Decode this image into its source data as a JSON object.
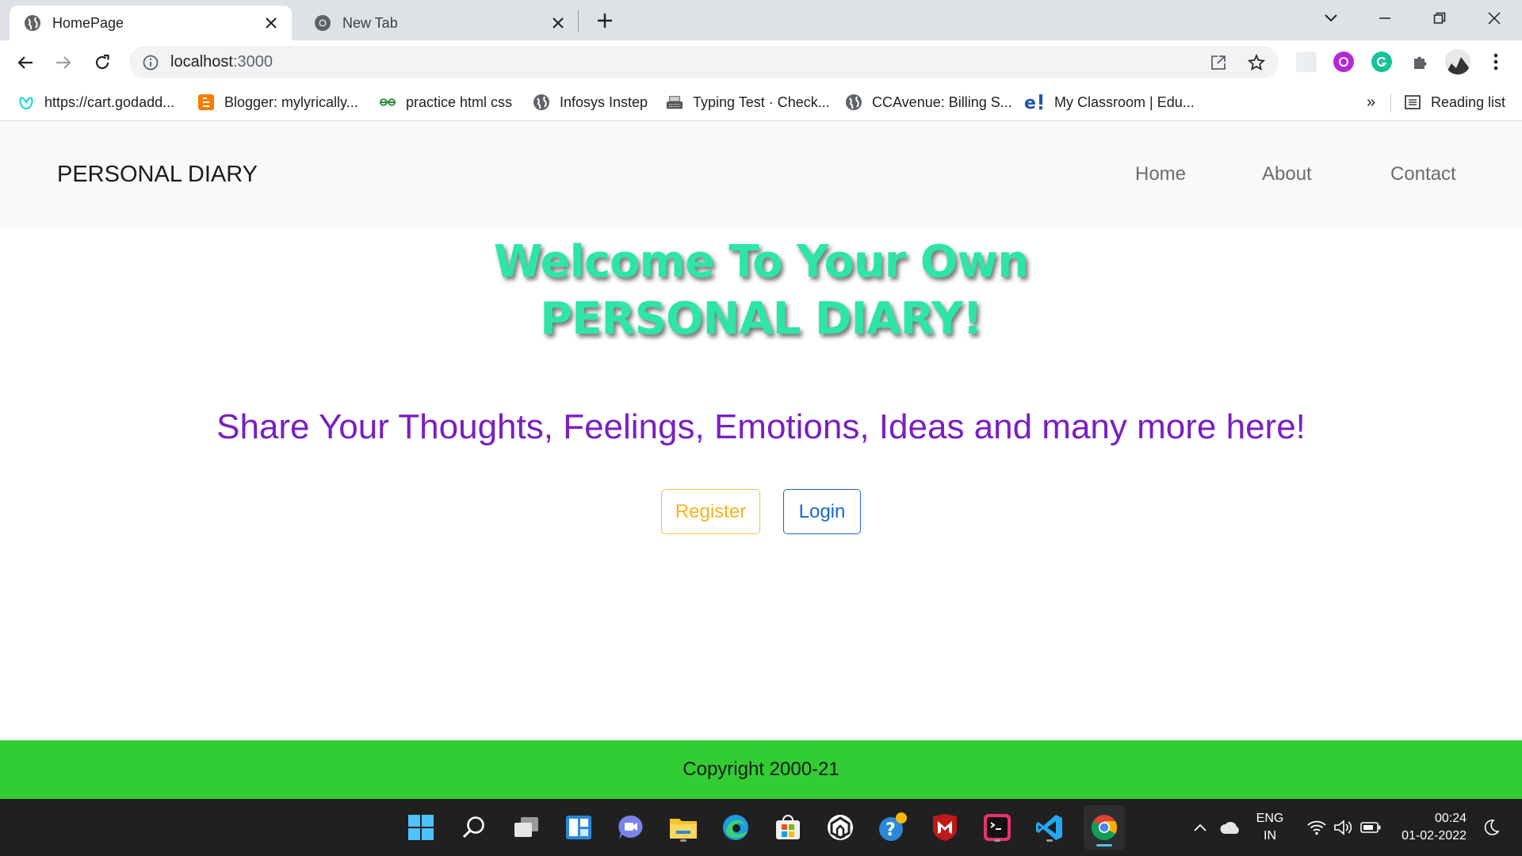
{
  "browser": {
    "tabs": [
      {
        "title": "HomePage",
        "active": true
      },
      {
        "title": "New Tab",
        "active": false
      }
    ],
    "url_host": "localhost",
    "url_port": ":3000",
    "bookmarks": [
      {
        "label": "https://cart.godadd...",
        "icon": "godaddy-icon"
      },
      {
        "label": "Blogger: mylyrically...",
        "icon": "blogger-icon"
      },
      {
        "label": "practice html css",
        "icon": "geeksforgeeks-icon"
      },
      {
        "label": "Infosys Instep",
        "icon": "globe-icon"
      },
      {
        "label": "Typing Test · Check...",
        "icon": "typewriter-icon"
      },
      {
        "label": "CCAvenue: Billing S...",
        "icon": "globe-icon"
      },
      {
        "label": "My Classroom | Edu...",
        "icon": "edureka-icon"
      }
    ],
    "bookmarks_overflow": "»",
    "reading_list": "Reading list"
  },
  "site": {
    "brand": "PERSONAL DIARY",
    "nav": [
      "Home",
      "About",
      "Contact"
    ],
    "hero_line1": "Welcome To Your Own",
    "hero_line2": "PERSONAL DIARY!",
    "tagline": "Share Your Thoughts, Feelings, Emotions, Ideas and many more here!",
    "register_label": "Register",
    "login_label": "Login",
    "footer": "Copyright 2000-21",
    "colors": {
      "hero": "#2ee5a8",
      "tagline": "#7a1fc2",
      "register": "#f3b51d",
      "login": "#1967d2",
      "footer_bg": "#32cd32"
    }
  },
  "taskbar": {
    "lang_top": "ENG",
    "lang_bottom": "IN",
    "time": "00:24",
    "date": "01-02-2022"
  }
}
